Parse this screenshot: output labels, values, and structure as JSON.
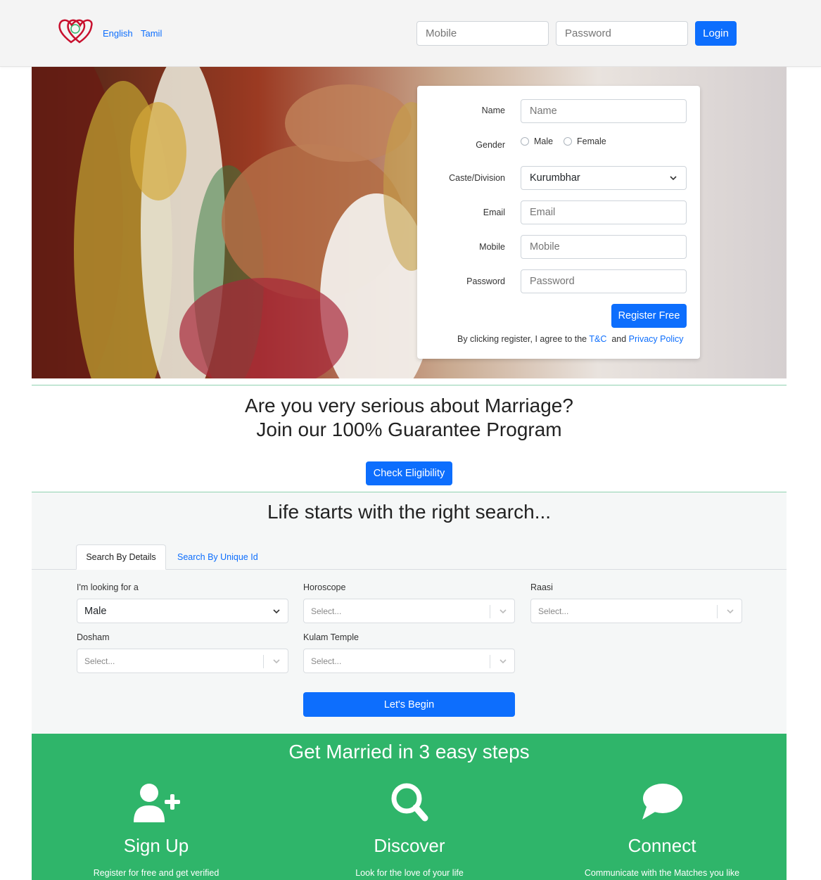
{
  "header": {
    "languages": [
      "English",
      "Tamil"
    ],
    "mobile_placeholder": "Mobile",
    "password_placeholder": "Password",
    "login_label": "Login"
  },
  "register": {
    "name_label": "Name",
    "name_placeholder": "Name",
    "gender_label": "Gender",
    "gender_options": [
      "Male",
      "Female"
    ],
    "caste_label": "Caste/Division",
    "caste_value": "Kurumbhar",
    "email_label": "Email",
    "email_placeholder": "Email",
    "mobile_label": "Mobile",
    "mobile_placeholder": "Mobile",
    "password_label": "Password",
    "password_placeholder": "Password",
    "submit_label": "Register Free",
    "terms_prefix": "By clicking register, I agree to the",
    "terms_link": "T&C",
    "terms_and": "and",
    "privacy_link": "Privacy Policy"
  },
  "guarantee": {
    "line1": "Are you very serious about Marriage?",
    "line2": "Join our 100% Guarantee Program",
    "button": "Check Eligibility"
  },
  "search": {
    "title": "Life starts with the right search...",
    "tabs": [
      "Search By Details",
      "Search By Unique Id"
    ],
    "looking_label": "I'm looking for a",
    "looking_value": "Male",
    "horoscope_label": "Horoscope",
    "raasi_label": "Raasi",
    "dosham_label": "Dosham",
    "kulam_label": "Kulam Temple",
    "select_placeholder": "Select...",
    "begin_button": "Let's Begin"
  },
  "steps": {
    "title": "Get Married in 3 easy steps",
    "items": [
      {
        "title": "Sign Up",
        "desc": "Register for free and get verified",
        "icon": "user-plus-icon"
      },
      {
        "title": "Discover",
        "desc": "Look for the love of your life",
        "icon": "search-icon"
      },
      {
        "title": "Connect",
        "desc": "Communicate with the Matches you like",
        "icon": "chat-bubble-icon"
      }
    ]
  },
  "colors": {
    "primary": "#0d6efd",
    "steps_bg": "#2fb56a",
    "logo_red": "#c8102e"
  }
}
